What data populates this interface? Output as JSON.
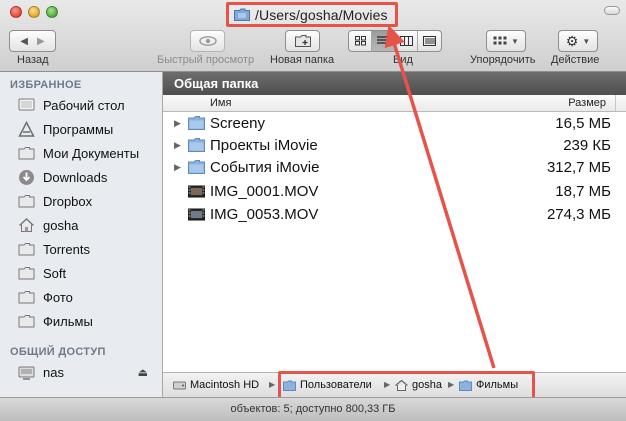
{
  "window": {
    "title": "/Users/gosha/Movies"
  },
  "toolbar": {
    "back_label": "Назад",
    "quicklook_label": "Быстрый просмотр",
    "new_folder_label": "Новая папка",
    "view_label": "Вид",
    "arrange_label": "Упорядочить",
    "action_label": "Действие",
    "view_mode_active": "list"
  },
  "sidebar": {
    "favorites_heading": "ИЗБРАННОЕ",
    "items": [
      {
        "label": "Рабочий стол",
        "icon": "desktop-icon"
      },
      {
        "label": "Программы",
        "icon": "applications-icon"
      },
      {
        "label": "Мои Документы",
        "icon": "folder-icon"
      },
      {
        "label": "Downloads",
        "icon": "downloads-icon"
      },
      {
        "label": "Dropbox",
        "icon": "folder-icon"
      },
      {
        "label": "gosha",
        "icon": "home-icon"
      },
      {
        "label": "Torrents",
        "icon": "folder-icon"
      },
      {
        "label": "Soft",
        "icon": "folder-icon"
      },
      {
        "label": "Фото",
        "icon": "folder-icon"
      },
      {
        "label": "Фильмы",
        "icon": "folder-icon"
      }
    ],
    "shared_heading": "ОБЩИЙ ДОСТУП",
    "shared_items": [
      {
        "label": "nas",
        "icon": "server-icon"
      }
    ]
  },
  "main": {
    "folder_header": "Общая папка",
    "columns": {
      "name": "Имя",
      "size": "Размер"
    },
    "files": [
      {
        "name": "Screeny",
        "size": "16,5 МБ",
        "type": "folder"
      },
      {
        "name": "Проекты iMovie",
        "size": "239 КБ",
        "type": "folder"
      },
      {
        "name": "События iMovie",
        "size": "312,7 МБ",
        "type": "folder"
      },
      {
        "name": "IMG_0001.MOV",
        "size": "18,7 МБ",
        "type": "movie"
      },
      {
        "name": "IMG_0053.MOV",
        "size": "274,3 МБ",
        "type": "movie"
      }
    ]
  },
  "path_bar": {
    "items": [
      {
        "label": "Macintosh HD",
        "icon": "hard-drive-icon"
      },
      {
        "label": "Пользователи",
        "icon": "folder-icon"
      },
      {
        "label": "gosha",
        "icon": "home-icon"
      },
      {
        "label": "Фильмы",
        "icon": "folder-icon"
      }
    ]
  },
  "status": {
    "text": "объектов: 5; доступно 800,33 ГБ"
  },
  "colors": {
    "annotation": "#e5544b",
    "folder_blue": "#7fa8d6",
    "sidebar_bg": "#e8ecf1"
  }
}
